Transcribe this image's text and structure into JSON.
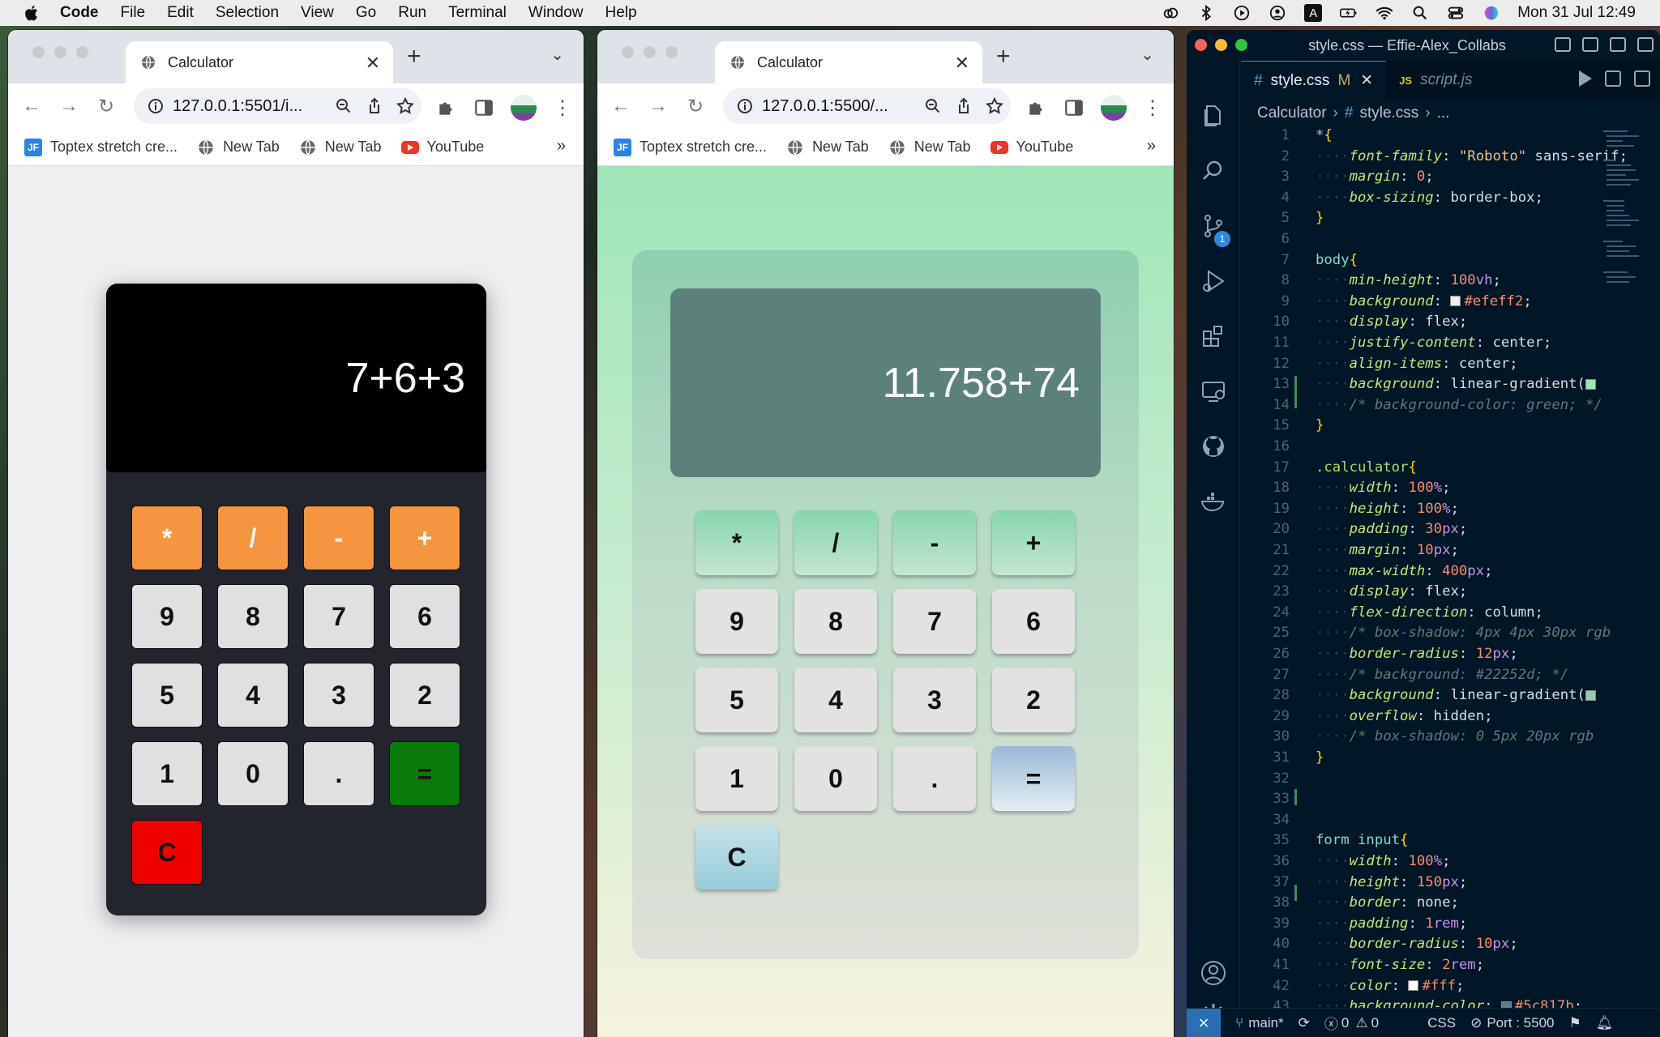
{
  "menubar": {
    "app_name": "Code",
    "items": [
      "File",
      "Edit",
      "Selection",
      "View",
      "Go",
      "Run",
      "Terminal",
      "Window",
      "Help"
    ],
    "clock": "Mon 31 Jul  12:49",
    "keyboard_indicator": "A"
  },
  "browser_left": {
    "tab_title": "Calculator",
    "url": "127.0.0.1:5501/i...",
    "bookmarks": [
      "Toptex stretch cre...",
      "New Tab",
      "New Tab",
      "YouTube"
    ],
    "bookmark_icon_jf": "JF",
    "bookmarks_more": "»",
    "display_value": "7+6+3",
    "keys": [
      "*",
      "/",
      "-",
      "+",
      "9",
      "8",
      "7",
      "6",
      "5",
      "4",
      "3",
      "2",
      "1",
      "0",
      ".",
      "=",
      "C"
    ]
  },
  "browser_right": {
    "tab_title": "Calculator",
    "url": "127.0.0.1:5500/...",
    "bookmarks": [
      "Toptex stretch cre...",
      "New Tab",
      "New Tab",
      "YouTube"
    ],
    "bookmark_icon_jf": "JF",
    "bookmarks_more": "»",
    "display_value": "11.758+74",
    "keys": [
      "*",
      "/",
      "-",
      "+",
      "9",
      "8",
      "7",
      "6",
      "5",
      "4",
      "3",
      "2",
      "1",
      "0",
      ".",
      "=",
      "C"
    ]
  },
  "vscode": {
    "title": "style.css — Effie-Alex_Collabs",
    "tabs": [
      {
        "label": "style.css",
        "modified": "M",
        "icon": "#"
      },
      {
        "label": "script.js",
        "icon": "JS"
      }
    ],
    "breadcrumb": [
      "Calculator",
      "style.css",
      "..."
    ],
    "scm_badge": "1",
    "status": {
      "branch": "main*",
      "errors": "0",
      "warnings": "0",
      "language": "CSS",
      "port": "Port : 5500"
    },
    "line_numbers": [
      "1",
      "2",
      "3",
      "4",
      "5",
      "6",
      "7",
      "8",
      "9",
      "10",
      "11",
      "12",
      "13",
      "14",
      "15",
      "16",
      "17",
      "18",
      "19",
      "20",
      "21",
      "22",
      "23",
      "24",
      "25",
      "26",
      "27",
      "28",
      "29",
      "30",
      "31",
      "32",
      "33",
      "34",
      "35",
      "36",
      "37",
      "38",
      "39",
      "40",
      "41",
      "42",
      "43"
    ]
  },
  "colors": {
    "calc1_operator": "#f5953f",
    "calc1_equals": "#0a7a0a",
    "calc1_clear": "#f10000",
    "calc2_display": "#5c817b",
    "page1_background": "#efeff2"
  }
}
